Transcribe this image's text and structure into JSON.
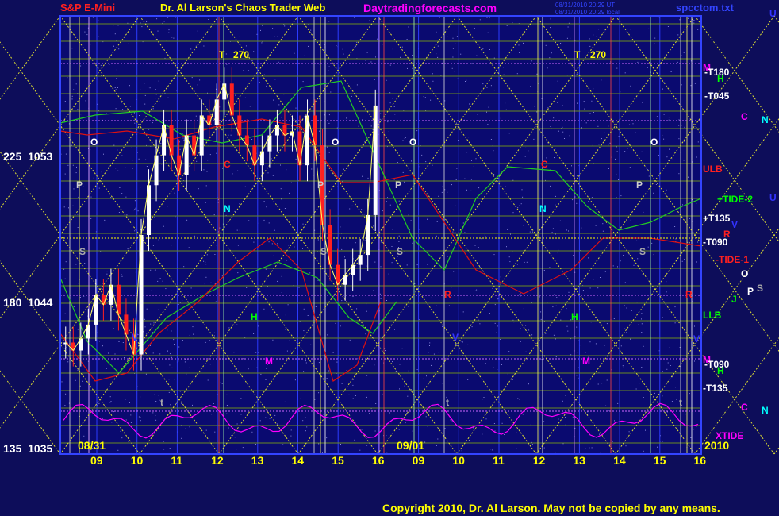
{
  "header": {
    "instrument": "S&P E-Mini",
    "site_title": "Dr. Al Larson's Chaos Trader Web",
    "site_url": "Daytradingforecasts.com",
    "timestamp_1": "08/31/2010 20:29 UT",
    "timestamp_2": "08/31/2010 20:29 local",
    "filename": "spcctom.txt"
  },
  "y_axis": [
    {
      "angle": "225",
      "price": "1053"
    },
    {
      "angle": "180",
      "price": "1044"
    },
    {
      "angle": "135",
      "price": "1035"
    }
  ],
  "x_axis": {
    "hours": [
      "09",
      "10",
      "11",
      "12",
      "13",
      "14",
      "15",
      "16",
      "09",
      "10",
      "11",
      "12",
      "13",
      "14",
      "15",
      "16"
    ],
    "dates": [
      "08/31",
      "09/01"
    ],
    "year": "2010"
  },
  "right_labels": [
    {
      "text": "M",
      "color": "#ff00ff"
    },
    {
      "text": "-T180",
      "color": "#ffffff"
    },
    {
      "text": "H",
      "color": "#00ff00"
    },
    {
      "text": "-T045",
      "color": "#ffffff"
    },
    {
      "text": "C",
      "color": "#ff00ff"
    },
    {
      "text": "N",
      "color": "#00ffff"
    },
    {
      "text": "ULB",
      "color": "#ff2020"
    },
    {
      "text": "+TIDE-2",
      "color": "#00ff00"
    },
    {
      "text": "+T135",
      "color": "#ffffff"
    },
    {
      "text": "V",
      "color": "#3333ff"
    },
    {
      "text": "R",
      "color": "#ff2020"
    },
    {
      "text": "-T090",
      "color": "#ffffff"
    },
    {
      "text": "-TIDE-1",
      "color": "#ff2020"
    },
    {
      "text": "O",
      "color": "#ffffff"
    },
    {
      "text": "P",
      "color": "#ffffff"
    },
    {
      "text": "S",
      "color": "#aaaaaa"
    },
    {
      "text": "J",
      "color": "#00ff00"
    },
    {
      "text": "LLB",
      "color": "#00ff00"
    },
    {
      "text": "V",
      "color": "#3333ff"
    },
    {
      "text": "M",
      "color": "#ff00ff"
    },
    {
      "text": "-T090",
      "color": "#ffffff"
    },
    {
      "text": "H",
      "color": "#00ff00"
    },
    {
      "text": "-T135",
      "color": "#ffffff"
    },
    {
      "text": "C",
      "color": "#ff00ff"
    },
    {
      "text": "N",
      "color": "#00ffff"
    },
    {
      "text": "XTIDE",
      "color": "#ff00ff"
    },
    {
      "text": "U",
      "color": "#3333ff"
    },
    {
      "text": "U",
      "color": "#3333ff"
    }
  ],
  "chart_markers": [
    {
      "text": "T",
      "color": "#ffff00"
    },
    {
      "text": "270",
      "color": "#ffff00"
    },
    {
      "text": "T",
      "color": "#ffff00"
    },
    {
      "text": "270",
      "color": "#ffff00"
    },
    {
      "text": "O",
      "color": "#ffffff"
    },
    {
      "text": "O",
      "color": "#ffffff"
    },
    {
      "text": "O",
      "color": "#ffffff"
    },
    {
      "text": "O",
      "color": "#ffffff"
    },
    {
      "text": "P",
      "color": "#cccccc"
    },
    {
      "text": "P",
      "color": "#cccccc"
    },
    {
      "text": "P",
      "color": "#cccccc"
    },
    {
      "text": "P",
      "color": "#cccccc"
    },
    {
      "text": "S",
      "color": "#aaaaaa"
    },
    {
      "text": "S",
      "color": "#aaaaaa"
    },
    {
      "text": "S",
      "color": "#aaaaaa"
    },
    {
      "text": "S",
      "color": "#aaaaaa"
    },
    {
      "text": "C",
      "color": "#ff2020"
    },
    {
      "text": "C",
      "color": "#ff2020"
    },
    {
      "text": "N",
      "color": "#00ffff"
    },
    {
      "text": "N",
      "color": "#00ffff"
    },
    {
      "text": "H",
      "color": "#00ff00"
    },
    {
      "text": "H",
      "color": "#00ff00"
    },
    {
      "text": "M",
      "color": "#ff00ff"
    },
    {
      "text": "M",
      "color": "#ff00ff"
    },
    {
      "text": "V",
      "color": "#3333ff"
    },
    {
      "text": "V",
      "color": "#3333ff"
    },
    {
      "text": "t",
      "color": "#aaaaaa"
    },
    {
      "text": "t",
      "color": "#aaaaaa"
    },
    {
      "text": "t",
      "color": "#aaaaaa"
    },
    {
      "text": "R",
      "color": "#ff2020"
    },
    {
      "text": "R",
      "color": "#ff2020"
    }
  ],
  "copyright": "Copyright 2010, Dr. Al Larson. May not be copied by any means.",
  "colors": {
    "background": "#0d0d5a",
    "plot_bg": "#0a0a70",
    "grid": "#3344ff",
    "price_up": "#ffffff",
    "price_down": "#ff2020",
    "xtide": "#ff00ff",
    "tide_green": "#22cc22",
    "tide_red": "#dd1111",
    "yellow": "#ffff00"
  },
  "chart_data": {
    "type": "candlestick",
    "title": "S&P E-Mini",
    "y_range": [
      1035,
      1057
    ],
    "y_ticks": [
      1035,
      1044,
      1053
    ],
    "x_ticks_day1": [
      "09",
      "10",
      "11",
      "12",
      "13",
      "14",
      "15",
      "16"
    ],
    "x_ticks_day2": [
      "09",
      "10",
      "11",
      "12",
      "13",
      "14",
      "15",
      "16"
    ],
    "series": [
      {
        "name": "price_close",
        "values": [
          1040.6,
          1040.2,
          1040.8,
          1041.5,
          1043.0,
          1042.5,
          1043.5,
          1042.0,
          1041.0,
          1040.0,
          1046.0,
          1048.5,
          1050.0,
          1051.5,
          1050.0,
          1049.0,
          1051.0,
          1050.0,
          1052.0,
          1051.5,
          1052.8,
          1053.6,
          1052.0,
          1051.0,
          1050.5,
          1049.5,
          1050.2,
          1051.0,
          1051.5,
          1051.0,
          1051.2,
          1049.5,
          1052.0,
          1050.5,
          1046.5,
          1044.5,
          1043.5,
          1044.0,
          1044.5,
          1045.0,
          1047.0,
          1052.5
        ]
      }
    ]
  }
}
